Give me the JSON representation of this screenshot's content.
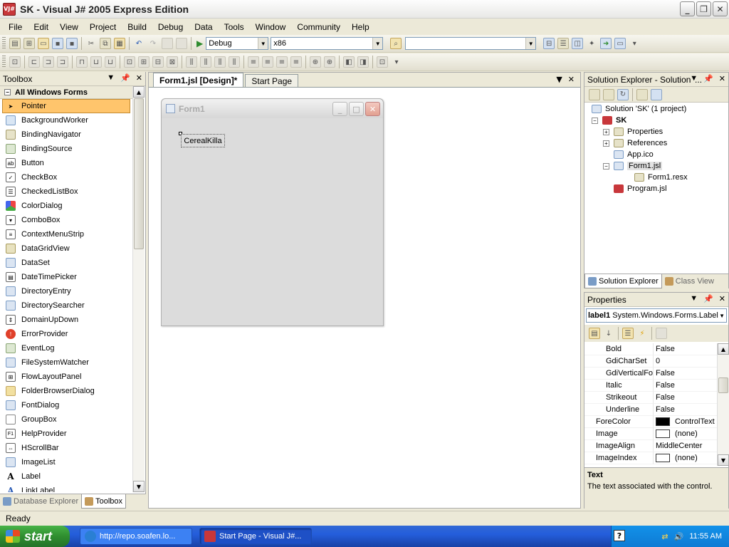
{
  "window": {
    "title": "SK - Visual J# 2005 Express Edition",
    "icon_text": "VJ#"
  },
  "menu": [
    "File",
    "Edit",
    "View",
    "Project",
    "Build",
    "Debug",
    "Data",
    "Tools",
    "Window",
    "Community",
    "Help"
  ],
  "toolbar": {
    "config": "Debug",
    "platform": "x86",
    "find": ""
  },
  "toolbox": {
    "title": "Toolbox",
    "category": "All Windows Forms",
    "items": [
      "Pointer",
      "BackgroundWorker",
      "BindingNavigator",
      "BindingSource",
      "Button",
      "CheckBox",
      "CheckedListBox",
      "ColorDialog",
      "ComboBox",
      "ContextMenuStrip",
      "DataGridView",
      "DataSet",
      "DateTimePicker",
      "DirectoryEntry",
      "DirectorySearcher",
      "DomainUpDown",
      "ErrorProvider",
      "EventLog",
      "FileSystemWatcher",
      "FlowLayoutPanel",
      "FolderBrowserDialog",
      "FontDialog",
      "GroupBox",
      "HelpProvider",
      "HScrollBar",
      "ImageList",
      "Label",
      "LinkLabel"
    ],
    "tabs": [
      "Database Explorer",
      "Toolbox"
    ]
  },
  "doc": {
    "tabs": [
      "Form1.jsl [Design]*",
      "Start Page"
    ],
    "form_title": "Form1",
    "label_text": "CerealKilla"
  },
  "solution": {
    "title": "Solution Explorer - Solution '...",
    "tree": [
      {
        "text": "Solution 'SK' (1 project)",
        "level": 0,
        "bold": false,
        "expander": ""
      },
      {
        "text": "SK",
        "level": 1,
        "bold": true,
        "expander": "−"
      },
      {
        "text": "Properties",
        "level": 2,
        "bold": false,
        "expander": "+"
      },
      {
        "text": "References",
        "level": 2,
        "bold": false,
        "expander": "+"
      },
      {
        "text": "App.ico",
        "level": 2,
        "bold": false,
        "expander": ""
      },
      {
        "text": "Form1.jsl",
        "level": 2,
        "bold": false,
        "expander": "−",
        "highlight": true
      },
      {
        "text": "Form1.resx",
        "level": 3,
        "bold": false,
        "expander": ""
      },
      {
        "text": "Program.jsl",
        "level": 2,
        "bold": false,
        "expander": ""
      }
    ],
    "tabs": [
      "Solution Explorer",
      "Class View"
    ]
  },
  "properties": {
    "title": "Properties",
    "object_name": "label1",
    "object_type": "System.Windows.Forms.Label",
    "rows": [
      {
        "name": "Bold",
        "value": "False",
        "child": true
      },
      {
        "name": "GdiCharSet",
        "value": "0",
        "child": true
      },
      {
        "name": "GdiVerticalFor",
        "value": "False",
        "child": true
      },
      {
        "name": "Italic",
        "value": "False",
        "child": true
      },
      {
        "name": "Strikeout",
        "value": "False",
        "child": true
      },
      {
        "name": "Underline",
        "value": "False",
        "child": true
      },
      {
        "name": "ForeColor",
        "value": "ControlText",
        "child": false,
        "swatch": "#000000"
      },
      {
        "name": "Image",
        "value": "(none)",
        "child": false,
        "swatch": "#ffffff"
      },
      {
        "name": "ImageAlign",
        "value": "MiddleCenter",
        "child": false
      },
      {
        "name": "ImageIndex",
        "value": "(none)",
        "child": false,
        "swatch": "#ffffff"
      }
    ],
    "desc_title": "Text",
    "desc_text": "The text associated with the control."
  },
  "status": "Ready",
  "taskbar": {
    "start": "start",
    "tasks": [
      "http://repo.soafen.lo...",
      "Start Page - Visual J#..."
    ],
    "clock": "11:55 AM"
  }
}
